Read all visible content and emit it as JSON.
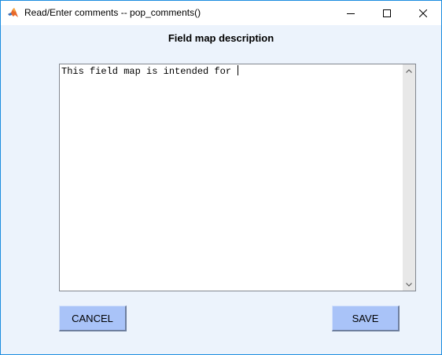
{
  "window": {
    "title": "Read/Enter comments -- pop_comments()",
    "controls": [
      "minimize-icon",
      "maximize-icon",
      "close-icon"
    ],
    "border_color": "#1c8de0",
    "background_color": "#ecf3fc"
  },
  "dialog": {
    "heading": "Field map description",
    "comment_text": "This field map is intended for ",
    "scrollbar": {
      "up_icon": "chevron-up-icon",
      "down_icon": "chevron-down-icon"
    }
  },
  "buttons": {
    "cancel_label": "CANCEL",
    "save_label": "SAVE",
    "color": "#a9c3f8"
  }
}
